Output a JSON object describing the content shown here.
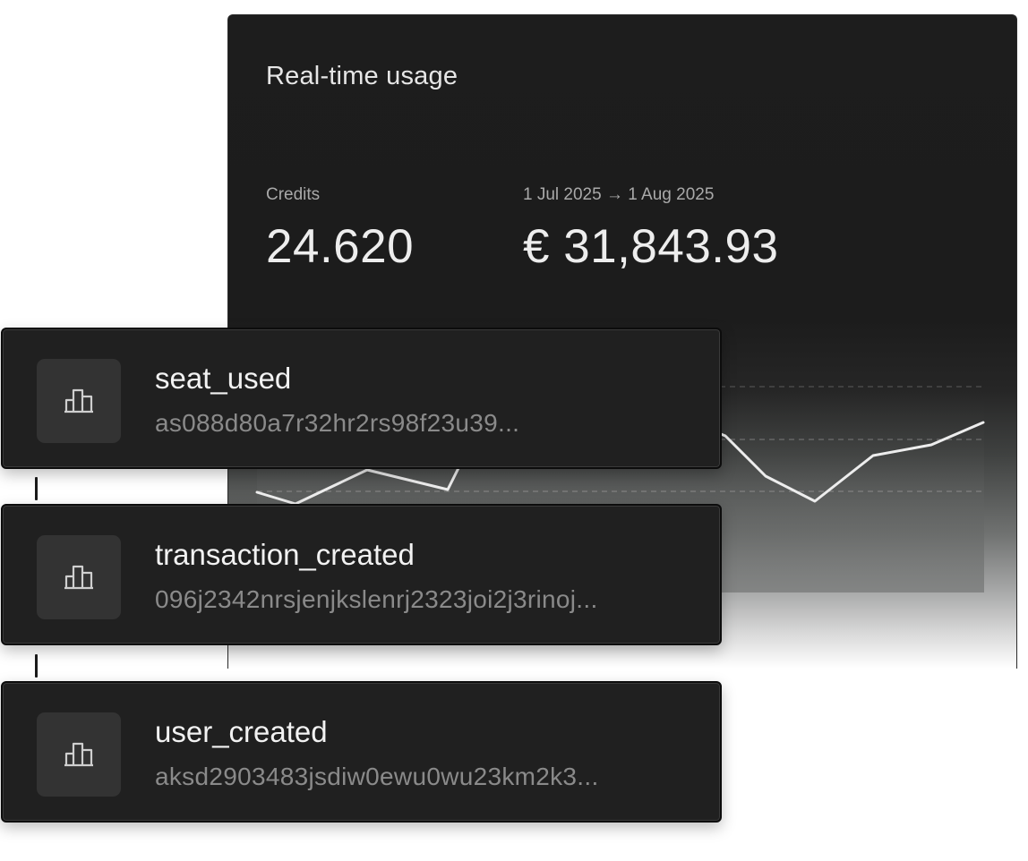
{
  "panel": {
    "title": "Real-time usage",
    "credits": {
      "label": "Credits",
      "value": "24.620"
    },
    "period": {
      "label": "1 Jul 2025 → 1 Aug 2025",
      "value": "€ 31,843.93"
    }
  },
  "events": [
    {
      "name": "seat_used",
      "id": "as088d80a7r32hr2rs98f23u39...",
      "icon": "bar-chart-icon"
    },
    {
      "name": "transaction_created",
      "id": "096j2342nrsjenjkslenrj2323joi2j3rinoj...",
      "icon": "bar-chart-icon"
    },
    {
      "name": "user_created",
      "id": "aksd2903483jsdiw0ewu0wu23km2k3...",
      "icon": "bar-chart-icon"
    }
  ],
  "colors": {
    "card_background": "#202020",
    "panel_background": "#1c1c1c",
    "primary_text": "#f2f2f2",
    "secondary_text": "#8a8a8a"
  }
}
